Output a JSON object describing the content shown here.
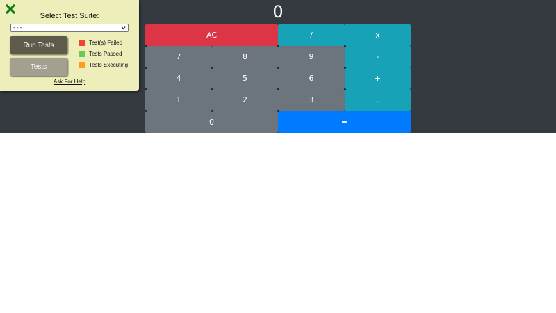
{
  "calculator": {
    "display": "0",
    "keys": {
      "ac": "AC",
      "divide": "/",
      "multiply": "x",
      "seven": "7",
      "eight": "8",
      "nine": "9",
      "minus": "-",
      "four": "4",
      "five": "5",
      "six": "6",
      "plus": "+",
      "one": "1",
      "two": "2",
      "three": "3",
      "decimal": ".",
      "zero": "0",
      "equals": "="
    },
    "colors": {
      "background": "#343a40",
      "number_key": "#6c757d",
      "clear_key": "#dc3545",
      "operator_key": "#17a2b8",
      "equals_key": "#007bff"
    }
  },
  "test_panel": {
    "title": "Select Test Suite:",
    "suite_select": {
      "selected": "- - -"
    },
    "run_button": "Run Tests",
    "tests_button": "Tests",
    "legend": [
      {
        "label": "Test(s) Failed",
        "color": "#f44336"
      },
      {
        "label": "Tests Passed",
        "color": "#66cc55"
      },
      {
        "label": "Tests Executing",
        "color": "#ff9d1c"
      }
    ],
    "help_link": "Ask For Help",
    "close_icon": "close-icon",
    "colors": {
      "panel_bg": "#eeeebb",
      "close": "#0a7a0a"
    }
  }
}
